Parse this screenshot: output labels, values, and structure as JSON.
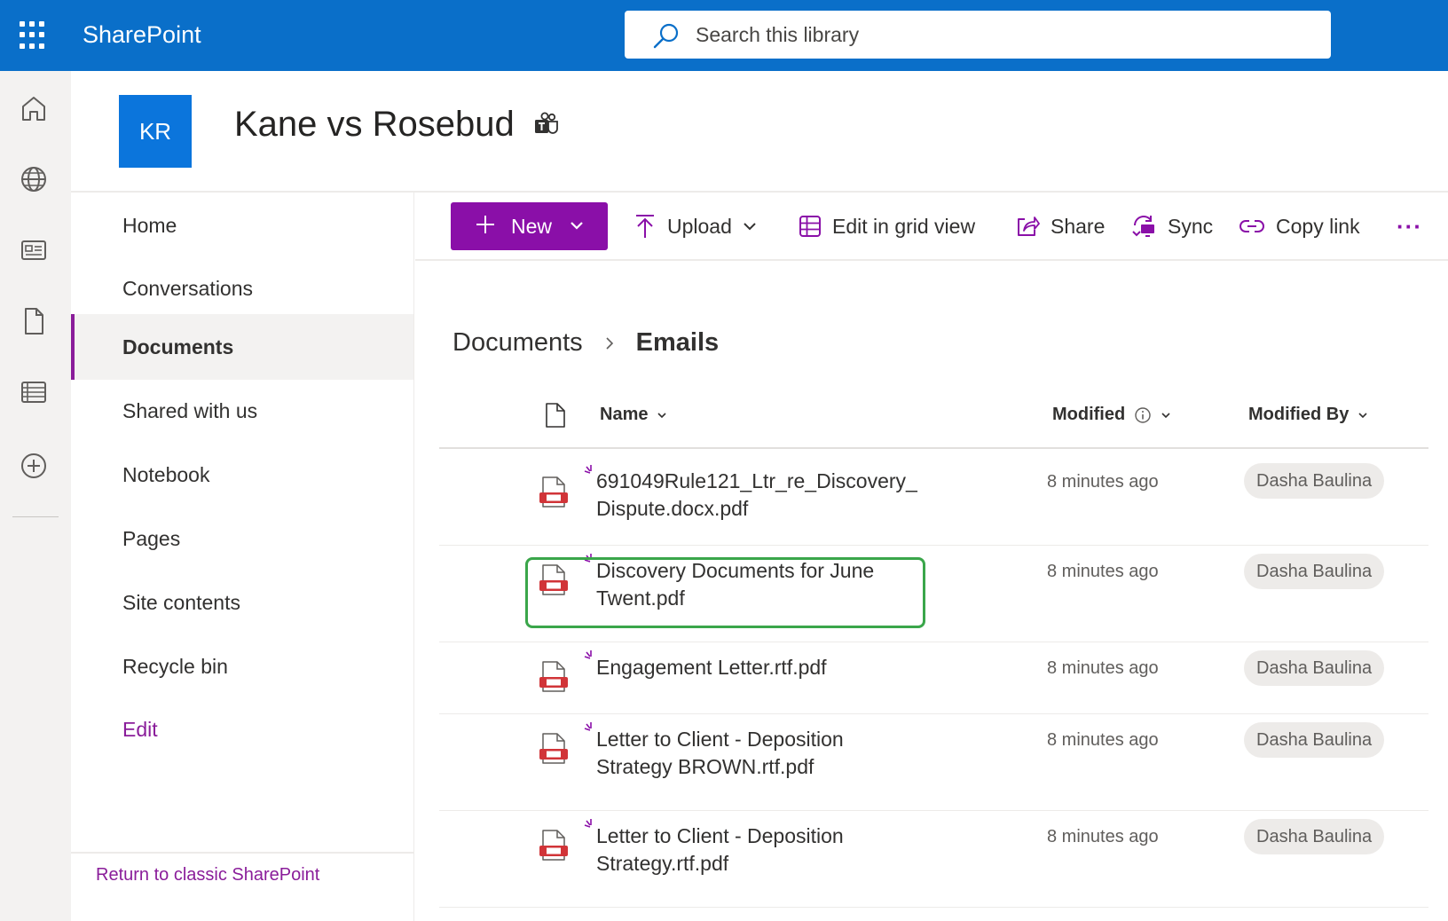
{
  "app": {
    "brand": "SharePoint",
    "search_placeholder": "Search this library"
  },
  "rail": {
    "items": [
      "home-icon",
      "globe-icon",
      "news-icon",
      "document-icon",
      "list-icon",
      "add-icon"
    ]
  },
  "site": {
    "logo_initials": "KR",
    "title": "Kane vs Rosebud"
  },
  "leftnav": {
    "items": [
      {
        "label": "Home"
      },
      {
        "label": "Conversations"
      },
      {
        "label": "Documents",
        "active": true
      },
      {
        "label": "Shared with us"
      },
      {
        "label": "Notebook"
      },
      {
        "label": "Pages"
      },
      {
        "label": "Site contents"
      },
      {
        "label": "Recycle bin"
      },
      {
        "label": "Edit"
      }
    ],
    "classic_link": "Return to classic SharePoint"
  },
  "commandbar": {
    "new_label": "New",
    "upload_label": "Upload",
    "grid_label": "Edit in grid view",
    "share_label": "Share",
    "sync_label": "Sync",
    "copy_link_label": "Copy link",
    "more_label": "···"
  },
  "breadcrumb": {
    "parent": "Documents",
    "current": "Emails"
  },
  "list": {
    "columns": {
      "name": "Name",
      "modified": "Modified",
      "modified_by": "Modified By"
    },
    "rows": [
      {
        "name_line1": "691049Rule121_Ltr_re_Discovery_",
        "name_line2": "Dispute.docx.pdf",
        "modified": "8 minutes ago",
        "modified_by": "Dasha Baulina"
      },
      {
        "name_line1": "Discovery Documents for June",
        "name_line2": "Twent.pdf",
        "modified": "8 minutes ago",
        "modified_by": "Dasha Baulina",
        "highlighted": true
      },
      {
        "name_line1": "Engagement Letter.rtf.pdf",
        "name_line2": "",
        "modified": "8 minutes ago",
        "modified_by": "Dasha Baulina"
      },
      {
        "name_line1": "Letter to Client - Deposition",
        "name_line2": "Strategy BROWN.rtf.pdf",
        "modified": "8 minutes ago",
        "modified_by": "Dasha Baulina"
      },
      {
        "name_line1": "Letter to Client - Deposition",
        "name_line2": "Strategy.rtf.pdf",
        "modified": "8 minutes ago",
        "modified_by": "Dasha Baulina"
      }
    ]
  },
  "colors": {
    "suite_bar": "#0a6fc9",
    "accent_purple": "#8a0fa8",
    "highlight_green": "#3aa64a",
    "pdf_red": "#d13438"
  }
}
